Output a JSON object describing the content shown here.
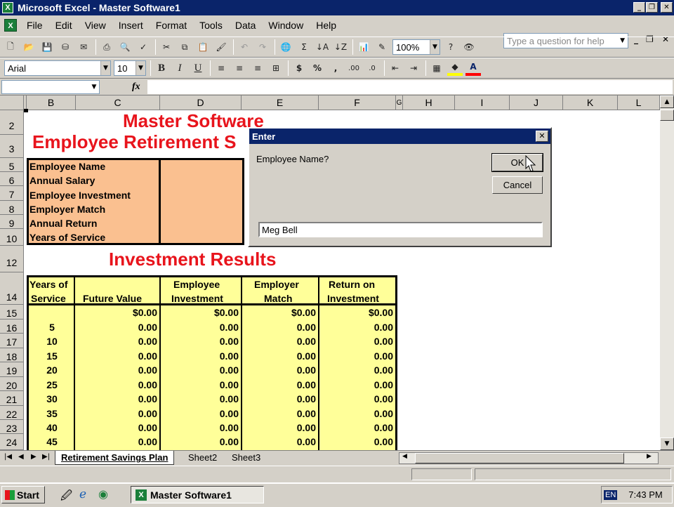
{
  "window": {
    "title": "Microsoft Excel - Master Software1",
    "app_icon": "X"
  },
  "menu": {
    "items": [
      "File",
      "Edit",
      "View",
      "Insert",
      "Format",
      "Tools",
      "Data",
      "Window",
      "Help"
    ],
    "ask_placeholder": "Type a question for help"
  },
  "toolbar": {
    "zoom": "100%",
    "font_name": "Arial",
    "font_size": "10"
  },
  "sheet": {
    "columns": [
      "B",
      "C",
      "D",
      "E",
      "F",
      "G",
      "H",
      "I",
      "J",
      "K",
      "L"
    ],
    "rows": [
      "2",
      "3",
      "5",
      "6",
      "7",
      "8",
      "9",
      "10",
      "12",
      "14",
      "15",
      "16",
      "17",
      "18",
      "19",
      "20",
      "21",
      "22",
      "23",
      "24"
    ],
    "title1": "Master Software",
    "title2": "Employee Retirement S",
    "input_labels": [
      "Employee Name",
      "Annual Salary",
      "Employee Investment",
      "Employer Match",
      "Annual Return",
      "Years of Service"
    ],
    "results_title": "Investment Results",
    "headers": [
      {
        "line1": "Years of",
        "line2": "Service"
      },
      {
        "line1": "",
        "line2": "Future Value"
      },
      {
        "line1": "Employee",
        "line2": "Investment"
      },
      {
        "line1": "Employer",
        "line2": "Match"
      },
      {
        "line1": "Return on",
        "line2": "Investment"
      }
    ],
    "first_row": [
      "",
      "$0.00",
      "$0.00",
      "$0.00",
      "$0.00"
    ],
    "years": [
      "5",
      "10",
      "15",
      "20",
      "25",
      "30",
      "35",
      "40",
      "45"
    ],
    "zero_value": "0.00",
    "input_fill": "#fac090",
    "results_fill": "#ffff99",
    "title_color": "#e8141c"
  },
  "tabs": [
    "Retirement Savings Plan",
    "Sheet2",
    "Sheet3"
  ],
  "dialog": {
    "title": "Enter",
    "prompt": "Employee Name?",
    "ok": "OK",
    "cancel": "Cancel",
    "value": "Meg Bell"
  },
  "taskbar": {
    "start": "Start",
    "task": "Master Software1",
    "lang": "EN",
    "time": "7:43 PM"
  }
}
